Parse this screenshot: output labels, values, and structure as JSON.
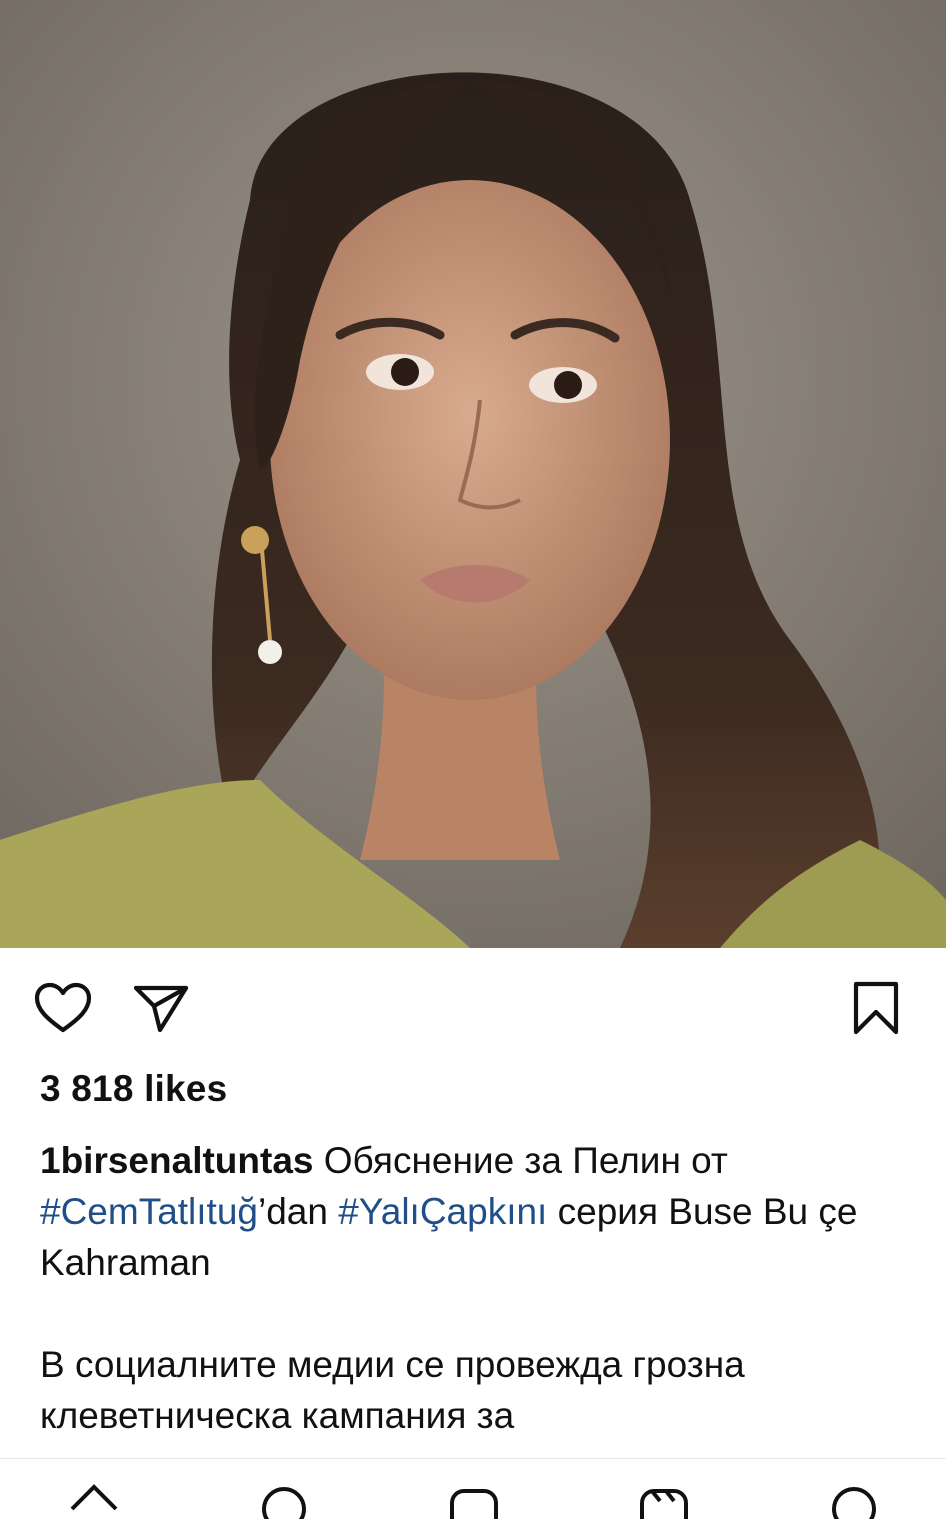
{
  "post": {
    "likes": "3 818 likes",
    "username": "1birsenaltuntas",
    "caption_text_1": " Обяснение за Пелин от ",
    "tag_1": "#CemTatlıtuğ",
    "caption_text_2": "’dan ",
    "tag_2": "#YalıÇapkını",
    "caption_text_3": " серия Buse Bu çe Kahraman",
    "caption_para_2": "В социалните медии се провежда грозна клеветническа кампания за"
  },
  "icons": {
    "like": "heart-icon",
    "share": "send-icon",
    "save": "bookmark-icon"
  },
  "colors": {
    "hashtag": "#1f4f86",
    "text": "#111111"
  }
}
